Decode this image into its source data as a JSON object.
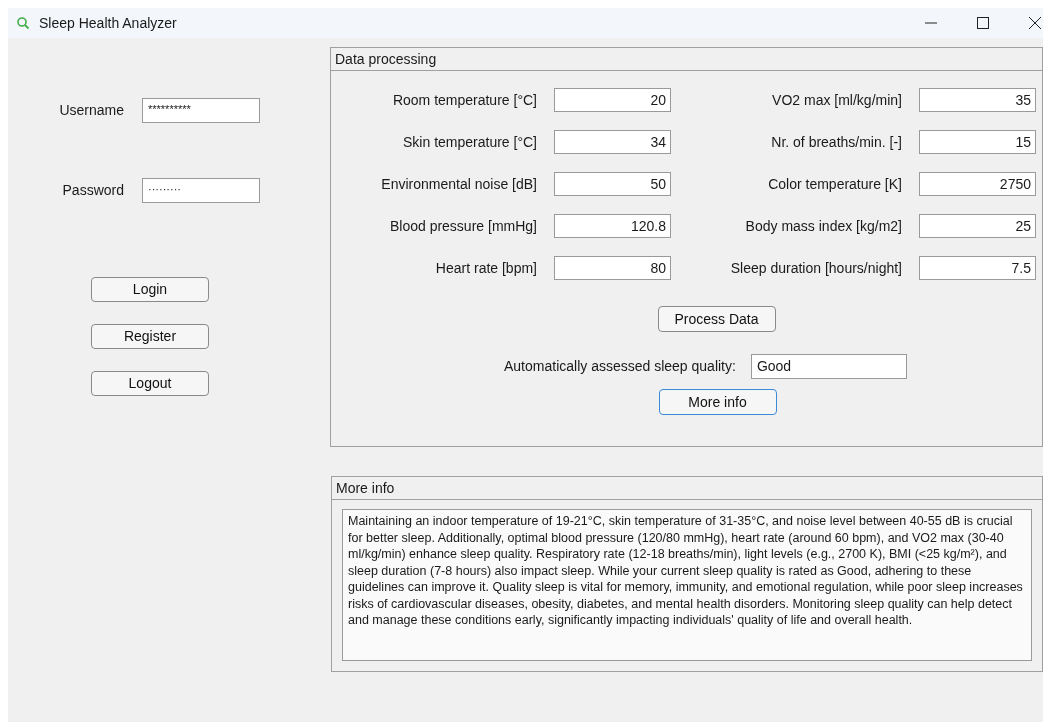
{
  "window": {
    "title": "Sleep Health Analyzer"
  },
  "login": {
    "fields": [
      {
        "label": "Username",
        "value": "**********"
      },
      {
        "label": "Password",
        "value": "·········"
      }
    ],
    "buttons": [
      {
        "label": "Login",
        "focused": false
      },
      {
        "label": "Register",
        "focused": false
      },
      {
        "label": "Logout",
        "focused": false
      }
    ]
  },
  "data_processing": {
    "title": "Data processing",
    "left_fields": [
      {
        "label": "Room temperature [°C]",
        "value": "20"
      },
      {
        "label": "Skin temperature [°C]",
        "value": "34"
      },
      {
        "label": "Environmental noise [dB]",
        "value": "50"
      },
      {
        "label": "Blood pressure [mmHg]",
        "value": "120.8"
      },
      {
        "label": "Heart rate [bpm]",
        "value": "80"
      }
    ],
    "right_fields": [
      {
        "label": "VO2 max [ml/kg/min]",
        "value": "35"
      },
      {
        "label": "Nr. of breaths/min. [-]",
        "value": "15"
      },
      {
        "label": "Color temperature [K]",
        "value": "2750"
      },
      {
        "label": "Body mass index [kg/m2]",
        "value": "25"
      },
      {
        "label": "Sleep duration [hours/night]",
        "value": "7.5"
      }
    ],
    "process_button": {
      "label": "Process Data",
      "focused": false
    },
    "quality": {
      "label": "Automatically assessed sleep quality:",
      "value": "Good"
    },
    "more_info_button": {
      "label": "More info",
      "focused": true
    }
  },
  "more_info": {
    "title": "More info",
    "text": "Maintaining an indoor temperature of 19-21°C, skin temperature of 31-35°C, and noise level between 40-55 dB is crucial for better sleep. Additionally, optimal blood pressure (120/80 mmHg), heart rate (around 60 bpm), and VO2 max (30-40 ml/kg/min) enhance sleep quality. Respiratory rate (12-18 breaths/min), light levels (e.g., 2700 K), BMI (<25 kg/m²), and sleep duration (7-8 hours) also impact sleep. While your current sleep quality is rated as Good, adhering to these guidelines can improve it. Quality sleep is vital for memory, immunity, and emotional regulation, while poor sleep increases risks of cardiovascular diseases, obesity, diabetes, and mental health disorders. Monitoring sleep quality can help detect and manage these conditions early, significantly impacting individuals' quality of life and overall health."
  }
}
